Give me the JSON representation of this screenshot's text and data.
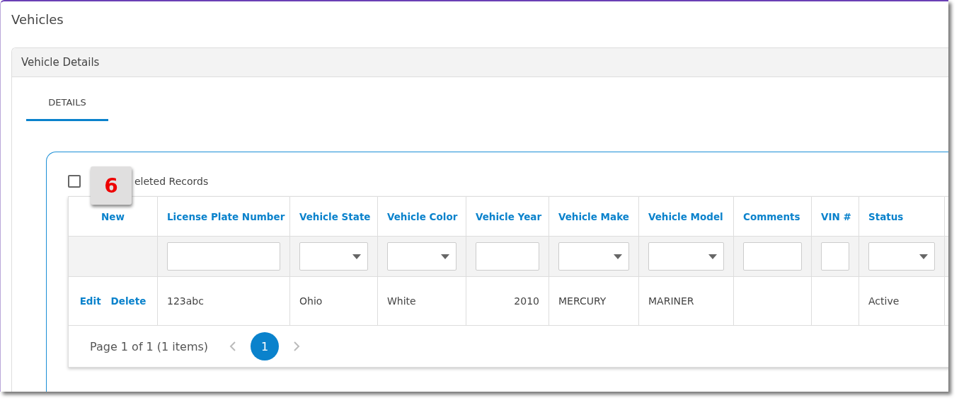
{
  "page": {
    "title": "Vehicles"
  },
  "panel": {
    "title": "Vehicle Details"
  },
  "tabs": [
    {
      "label": "DETAILS",
      "selected": true
    }
  ],
  "deleted_toggle": {
    "label": "eleted Records",
    "checked": false
  },
  "callout": {
    "text": "6"
  },
  "grid": {
    "columns": [
      {
        "label": "New",
        "kind": "action"
      },
      {
        "label": "License Plate Number",
        "kind": "text"
      },
      {
        "label": "Vehicle State",
        "kind": "text"
      },
      {
        "label": "Vehicle Color",
        "kind": "text"
      },
      {
        "label": "Vehicle Year",
        "kind": "number"
      },
      {
        "label": "Vehicle Make",
        "kind": "text"
      },
      {
        "label": "Vehicle Model",
        "kind": "text"
      },
      {
        "label": "Comments",
        "kind": "text"
      },
      {
        "label": "VIN #",
        "kind": "text"
      },
      {
        "label": "Status",
        "kind": "text"
      }
    ],
    "filters": [
      {
        "kind": "none"
      },
      {
        "kind": "text"
      },
      {
        "kind": "dropdown"
      },
      {
        "kind": "dropdown"
      },
      {
        "kind": "text"
      },
      {
        "kind": "dropdown"
      },
      {
        "kind": "dropdown"
      },
      {
        "kind": "text"
      },
      {
        "kind": "text"
      },
      {
        "kind": "dropdown"
      }
    ],
    "rows": [
      {
        "actions": [
          "Edit",
          "Delete"
        ],
        "cells": [
          "",
          "123abc",
          "Ohio",
          "White",
          "2010",
          "MERCURY",
          "MARINER",
          "",
          "",
          "Active"
        ]
      }
    ],
    "pager": {
      "summary": "Page 1 of 1 (1 items)",
      "pages": [
        {
          "label": "1",
          "selected": true
        }
      ]
    }
  }
}
